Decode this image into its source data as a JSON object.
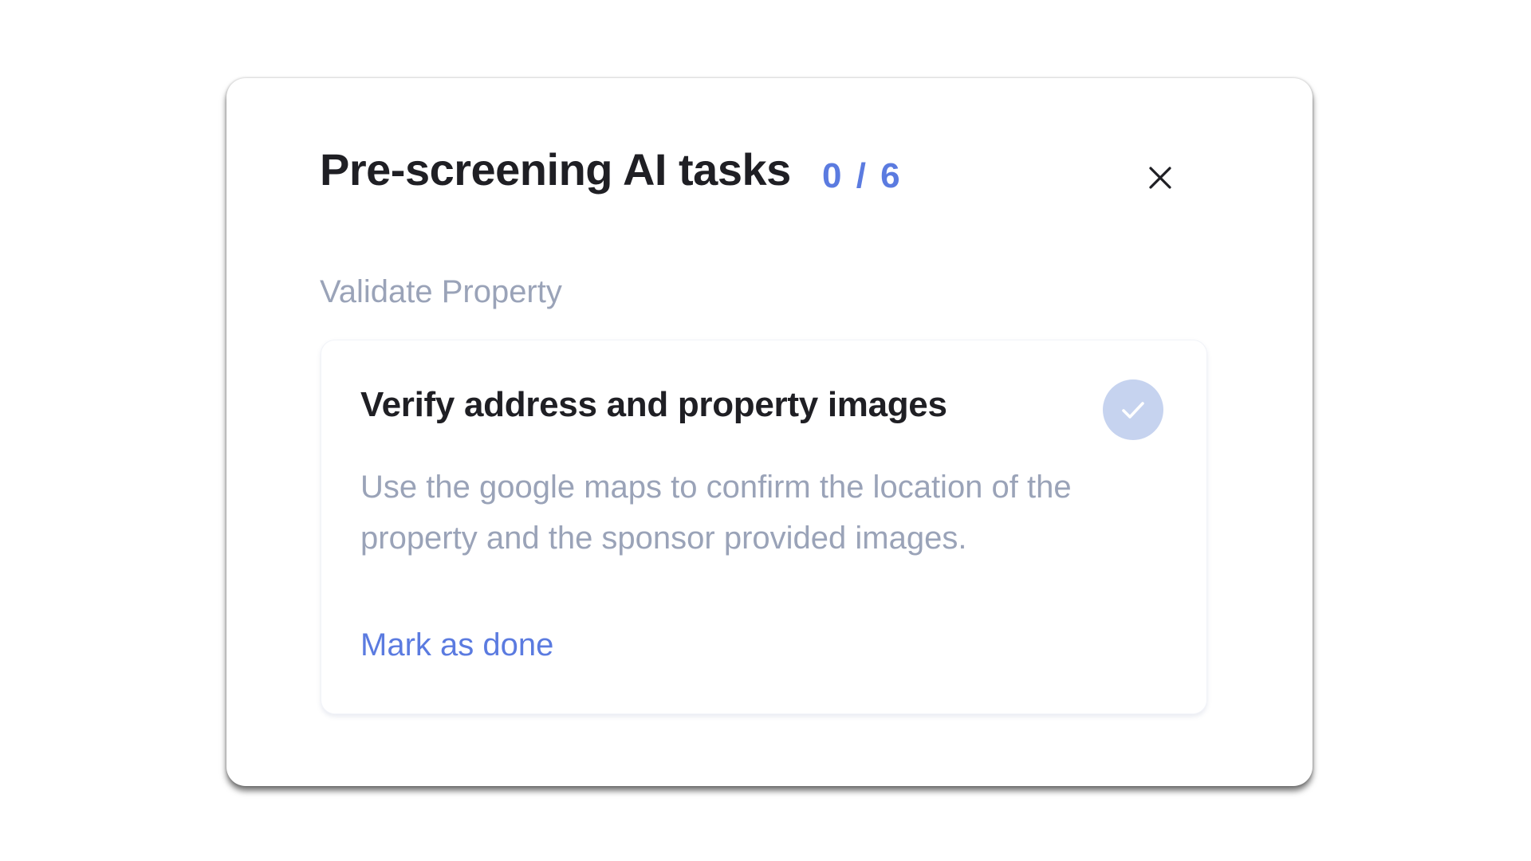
{
  "modal": {
    "title": "Pre-screening AI tasks",
    "counter": "0 / 6",
    "close_icon": "close-icon"
  },
  "section": {
    "heading": "Validate Property"
  },
  "task": {
    "title": "Verify address and property images",
    "description": "Use the google maps to confirm the location of the property and the sponsor provided images.",
    "status_icon": "check-icon",
    "status_color": "#c6d3ef",
    "action_label": "Mark as done"
  },
  "colors": {
    "accent": "#5b7be0",
    "muted_text": "#9aa3b8",
    "title_text": "#1f1f24"
  }
}
